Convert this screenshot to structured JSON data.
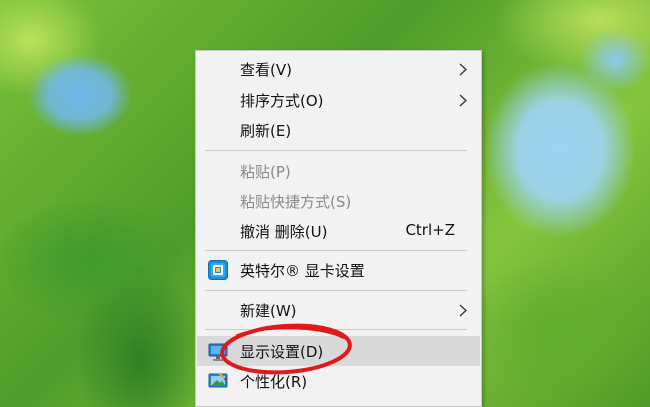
{
  "context_menu": {
    "items": [
      {
        "label": "查看(V)",
        "submenu": true
      },
      {
        "label": "排序方式(O)",
        "submenu": true
      },
      {
        "label": "刷新(E)"
      },
      {
        "label": "粘贴(P)",
        "disabled": true
      },
      {
        "label": "粘贴快捷方式(S)",
        "disabled": true
      },
      {
        "label": "撤消 删除(U)",
        "shortcut": "Ctrl+Z"
      },
      {
        "label": "英特尔® 显卡设置",
        "icon": "intel-graphics-icon"
      },
      {
        "label": "新建(W)",
        "submenu": true
      },
      {
        "label": "显示设置(D)",
        "icon": "display-settings-icon",
        "highlighted": true
      },
      {
        "label": "个性化(R)",
        "icon": "personalize-icon"
      }
    ]
  },
  "annotation": {
    "color": "#e01919"
  }
}
